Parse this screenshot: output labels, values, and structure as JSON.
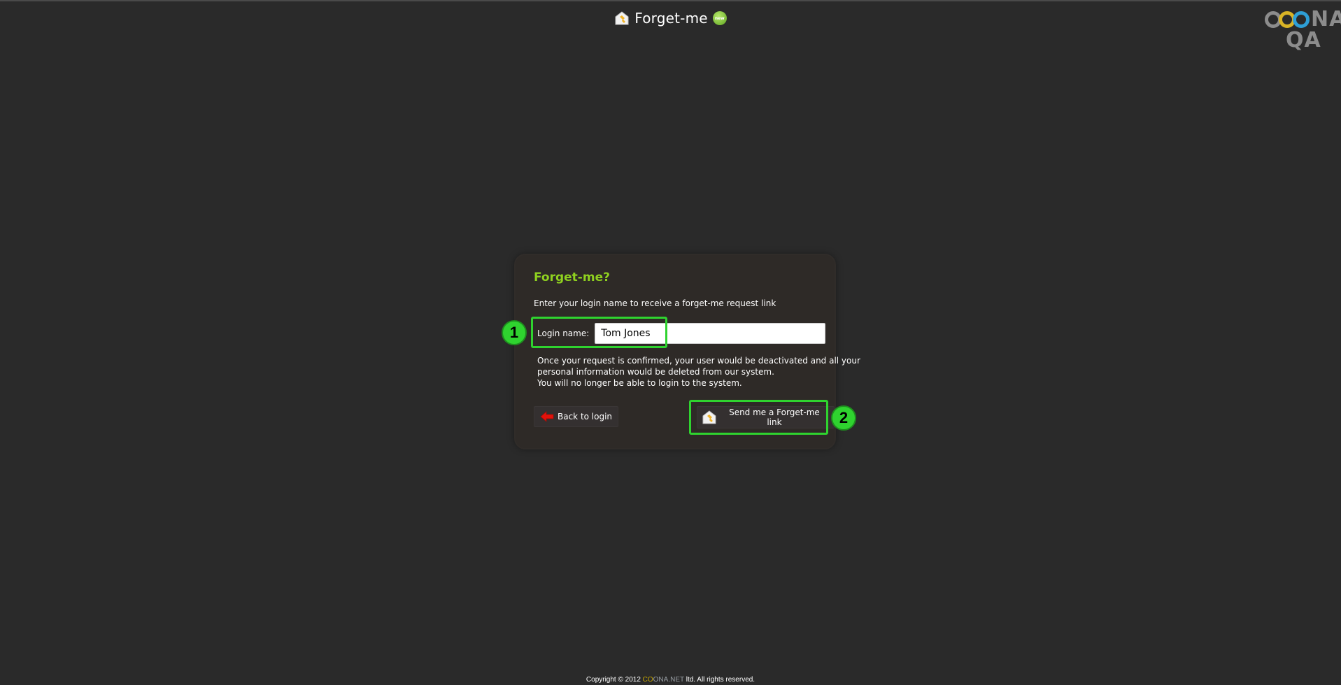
{
  "header": {
    "title": "Forget-me",
    "icon": "forget-me-house-icon",
    "badge_icon": "new-badge-icon",
    "badge_text": "new"
  },
  "brand": {
    "line1": "NA",
    "line2": "QA",
    "icon": "coona-rings-logo-icon"
  },
  "card": {
    "title": "Forget-me?",
    "subtitle": "Enter your login name to receive a forget-me request link",
    "login_label": "Login name:",
    "login_value": "Tom Jones",
    "warning_lines": [
      "Once your request is confirmed, your user would be deactivated and all your",
      "personal information would be deleted from our system.",
      "You will no longer be able to login to the system."
    ],
    "back_label": "Back to login",
    "back_icon": "red-arrow-left-icon",
    "send_label": "Send me a Forget-me link",
    "send_icon": "forget-me-house-icon"
  },
  "annotations": {
    "marker1": "1",
    "marker2": "2",
    "color": "#2fd32f"
  },
  "footer": {
    "prefix": "Copyright © 2012 ",
    "brand_co": "CO",
    "brand_rest": "ONA.NET",
    "suffix": " ltd. All rights reserved."
  },
  "colors": {
    "background": "#2a2a2a",
    "card": "#2e2a27",
    "title_green": "#8fd11f"
  }
}
